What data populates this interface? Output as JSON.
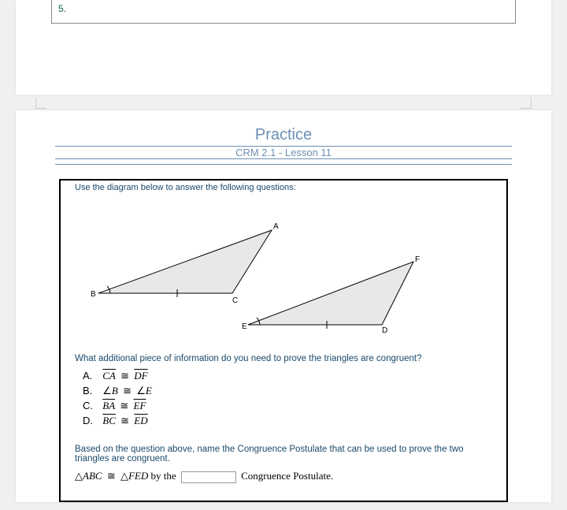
{
  "prev_item_number": "5.",
  "practice": {
    "heading": "Practice",
    "sub": "CRM 2.1 - Lesson 11"
  },
  "worksheet": {
    "instruction": "Use the diagram below to answer the following questions:",
    "diagram": {
      "tri1": {
        "A": "A",
        "B": "B",
        "C": "C"
      },
      "tri2": {
        "D": "D",
        "E": "E",
        "F": "F"
      }
    },
    "q1": "What additional piece of information do you need to prove the triangles are congruent?",
    "choices": {
      "A": {
        "letter": "A.",
        "lhs": "CA",
        "rhs": "DF",
        "kind": "segment"
      },
      "B": {
        "letter": "B.",
        "lhs": "B",
        "rhs": "E",
        "kind": "angle"
      },
      "C": {
        "letter": "C.",
        "lhs": "BA",
        "rhs": "EF",
        "kind": "segment"
      },
      "D": {
        "letter": "D.",
        "lhs": "BC",
        "rhs": "ED",
        "kind": "segment"
      }
    },
    "q2": "Based on the question above, name the Congruence Postulate that can be used to prove the two triangles are congruent.",
    "fill": {
      "lhs": "ABC",
      "rhs": "FED",
      "by_the": "by the",
      "postulate_label": "Congruence Postulate."
    }
  }
}
